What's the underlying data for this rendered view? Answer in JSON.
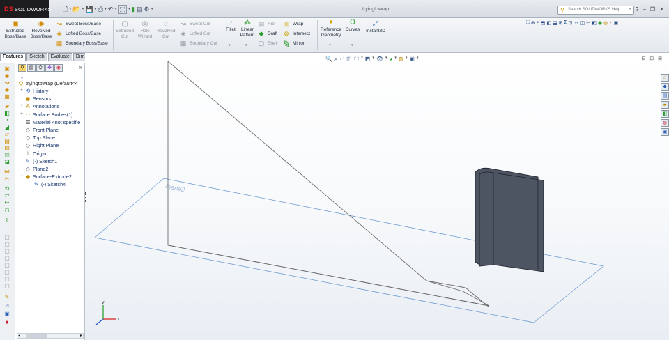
{
  "app": {
    "brand": "SOLIDWORKS",
    "brand_mark": "DS",
    "document_title": "tryingtowrap",
    "search_placeholder": "Search SOLIDWORKS Help"
  },
  "quick_access": [
    "new-icon",
    "open-icon",
    "save-icon",
    "print-icon",
    "undo-icon",
    "select-icon",
    "rebuild-icon",
    "options-icon"
  ],
  "command_manager": {
    "extruded_boss": "Extruded\nBoss/Base",
    "revolved_boss": "Revolved\nBoss/Base",
    "swept_boss": "Swept Boss/Base",
    "lofted_boss": "Lofted Boss/Base",
    "boundary_boss": "Boundary Boss/Base",
    "extruded_cut": "Extruded\nCut",
    "hole_wizard": "Hole\nWizard",
    "revolved_cut": "Revolved\nCut",
    "swept_cut": "Swept Cut",
    "lofted_cut": "Lofted Cut",
    "boundary_cut": "Boundary Cut",
    "fillet": "Fillet",
    "linear_pattern": "Linear\nPattern",
    "rib": "Rib",
    "draft": "Draft",
    "shell": "Shell",
    "wrap": "Wrap",
    "intersect": "Intersect",
    "mirror": "Mirror",
    "reference_geometry": "Reference\nGeometry",
    "curves": "Curves",
    "instant3d": "Instant3D"
  },
  "tabs": [
    "Features",
    "Sketch",
    "Evaluate",
    "DimXpert"
  ],
  "active_tab": "Features",
  "feature_tree": {
    "root": "tryingtowrap  (Default<<",
    "items": [
      {
        "label": "History",
        "icon": "history-icon",
        "expand": "+"
      },
      {
        "label": "Sensors",
        "icon": "sensors-icon",
        "expand": ""
      },
      {
        "label": "Annotations",
        "icon": "annotations-icon",
        "expand": "+"
      },
      {
        "label": "Surface Bodies(1)",
        "icon": "surface-bodies-icon",
        "expand": "+"
      },
      {
        "label": "Material <not specifie",
        "icon": "material-icon",
        "expand": ""
      },
      {
        "label": "Front Plane",
        "icon": "plane-icon",
        "expand": ""
      },
      {
        "label": "Top Plane",
        "icon": "plane-icon",
        "expand": ""
      },
      {
        "label": "Right Plane",
        "icon": "plane-icon",
        "expand": ""
      },
      {
        "label": "Origin",
        "icon": "origin-icon",
        "expand": ""
      },
      {
        "label": "(-) Sketch1",
        "icon": "sketch-icon",
        "expand": ""
      },
      {
        "label": "Plane2",
        "icon": "plane-icon",
        "expand": ""
      },
      {
        "label": "Surface-Extrude2",
        "icon": "surface-extrude-icon",
        "expand": "−"
      },
      {
        "label": "(-) Sketch4",
        "icon": "sketch-icon",
        "expand": "",
        "indent": 1
      }
    ]
  },
  "viewport": {
    "plane_label": "Plane2",
    "colors": {
      "plane_edge": "#6f9bd1",
      "sketch_line": "#6d6d6d",
      "body_face": "#4e5562",
      "body_edge": "#1d2028",
      "axis_x": "#d62222",
      "axis_y": "#1f9c1f",
      "axis_z": "#1f4fd6"
    }
  }
}
